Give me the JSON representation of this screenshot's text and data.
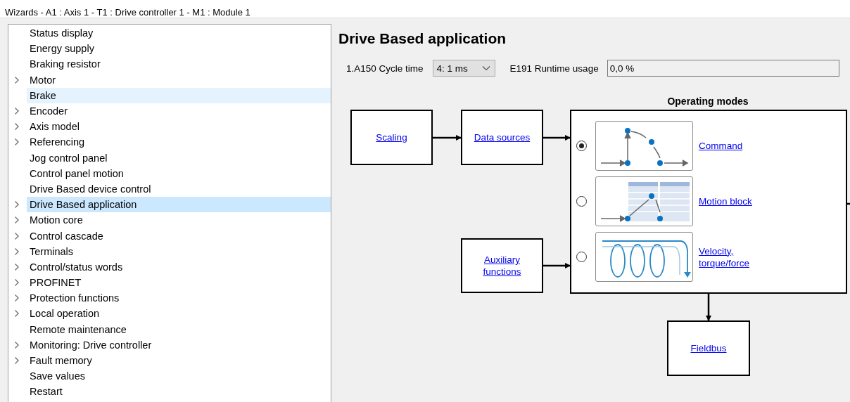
{
  "window": {
    "title": "Wizards - A1 : Axis 1 - T1 : Drive controller 1 - M1 : Module 1"
  },
  "tree": {
    "items": [
      {
        "label": "Status display",
        "expandable": false,
        "selected": false,
        "hovered": false
      },
      {
        "label": "Energy supply",
        "expandable": false,
        "selected": false,
        "hovered": false
      },
      {
        "label": "Braking resistor",
        "expandable": false,
        "selected": false,
        "hovered": false
      },
      {
        "label": "Motor",
        "expandable": true,
        "selected": false,
        "hovered": false
      },
      {
        "label": "Brake",
        "expandable": false,
        "selected": false,
        "hovered": true
      },
      {
        "label": "Encoder",
        "expandable": true,
        "selected": false,
        "hovered": false
      },
      {
        "label": "Axis model",
        "expandable": true,
        "selected": false,
        "hovered": false
      },
      {
        "label": "Referencing",
        "expandable": true,
        "selected": false,
        "hovered": false
      },
      {
        "label": "Jog control panel",
        "expandable": false,
        "selected": false,
        "hovered": false
      },
      {
        "label": "Control panel motion",
        "expandable": false,
        "selected": false,
        "hovered": false
      },
      {
        "label": "Drive Based device control",
        "expandable": false,
        "selected": false,
        "hovered": false
      },
      {
        "label": "Drive Based application",
        "expandable": true,
        "selected": true,
        "hovered": false
      },
      {
        "label": "Motion core",
        "expandable": true,
        "selected": false,
        "hovered": false
      },
      {
        "label": "Control cascade",
        "expandable": true,
        "selected": false,
        "hovered": false
      },
      {
        "label": "Terminals",
        "expandable": true,
        "selected": false,
        "hovered": false
      },
      {
        "label": "Control/status words",
        "expandable": true,
        "selected": false,
        "hovered": false
      },
      {
        "label": "PROFINET",
        "expandable": true,
        "selected": false,
        "hovered": false
      },
      {
        "label": "Protection functions",
        "expandable": true,
        "selected": false,
        "hovered": false
      },
      {
        "label": "Local operation",
        "expandable": true,
        "selected": false,
        "hovered": false
      },
      {
        "label": "Remote maintenance",
        "expandable": false,
        "selected": false,
        "hovered": false
      },
      {
        "label": "Monitoring: Drive controller",
        "expandable": true,
        "selected": false,
        "hovered": false
      },
      {
        "label": "Fault memory",
        "expandable": true,
        "selected": false,
        "hovered": false
      },
      {
        "label": "Save values",
        "expandable": false,
        "selected": false,
        "hovered": false
      },
      {
        "label": "Restart",
        "expandable": false,
        "selected": false,
        "hovered": false
      }
    ]
  },
  "page": {
    "heading": "Drive Based application",
    "cycle_time": {
      "label": "1.A150 Cycle time",
      "value": "4: 1 ms"
    },
    "runtime_usage": {
      "label": "E191 Runtime usage",
      "value": "0,0 %"
    }
  },
  "diagram": {
    "blocks": [
      {
        "label": "Scaling"
      },
      {
        "label": "Data sources"
      },
      {
        "label": "Auxiliary functions"
      },
      {
        "label": "Fieldbus"
      }
    ],
    "operating_modes": {
      "title": "Operating modes",
      "modes": [
        {
          "label": "Command",
          "kind": "command",
          "selected": true
        },
        {
          "label": "Motion block",
          "kind": "motion_block",
          "selected": false
        },
        {
          "label": "Velocity, torque/force",
          "kind": "velocity",
          "selected": false
        }
      ]
    }
  }
}
